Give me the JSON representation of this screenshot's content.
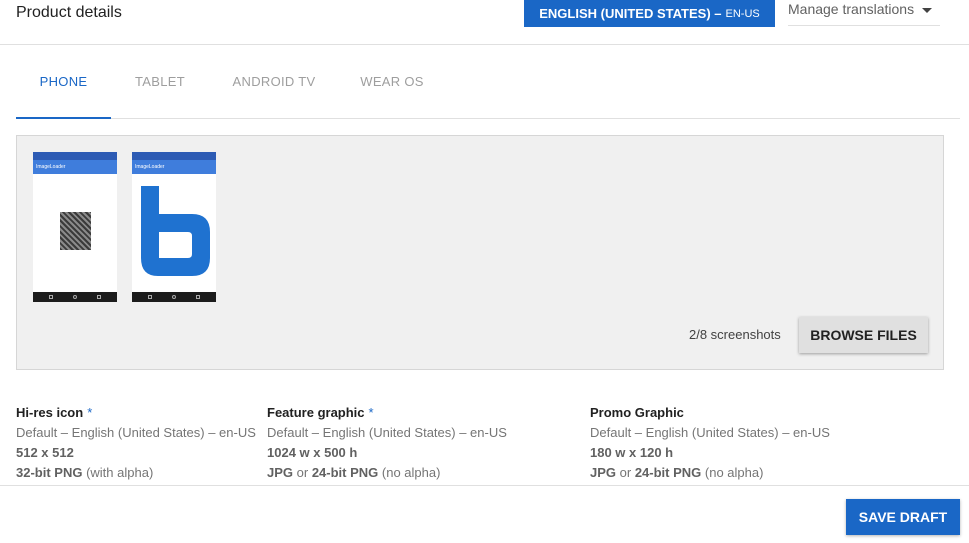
{
  "header": {
    "title": "Product details",
    "language_button": {
      "label": "ENGLISH (UNITED STATES) –",
      "code": "EN-US"
    },
    "manage_translations": "Manage translations"
  },
  "tabs": [
    {
      "label": "PHONE",
      "active": true
    },
    {
      "label": "TABLET",
      "active": false
    },
    {
      "label": "ANDROID TV",
      "active": false
    },
    {
      "label": "WEAR OS",
      "active": false
    }
  ],
  "screenshots": {
    "app_name": "ImageLoader",
    "count": "2/8 screenshots",
    "browse_label": "BROWSE FILES"
  },
  "assets": [
    {
      "title": "Hi-res icon",
      "required_mark": "*",
      "locale": "Default – English (United States) – en-US",
      "size": "512 x 512",
      "format_strong": "32-bit PNG",
      "format_rest": " (with alpha)"
    },
    {
      "title": "Feature graphic",
      "required_mark": "*",
      "locale": "Default – English (United States) – en-US",
      "size": "1024 w x 500 h",
      "format_strong": "JPG",
      "format_mid": " or ",
      "format_strong2": "24-bit PNG",
      "format_rest": " (no alpha)"
    },
    {
      "title": "Promo Graphic",
      "locale": "Default – English (United States) – en-US",
      "size": "180 w x 120 h",
      "format_strong": "JPG",
      "format_mid": " or ",
      "format_strong2": "24-bit PNG",
      "format_rest": " (no alpha)"
    }
  ],
  "footer": {
    "save_label": "SAVE DRAFT"
  },
  "colors": {
    "accent": "#1a67c6",
    "panel_bg": "#f0f0f0"
  }
}
